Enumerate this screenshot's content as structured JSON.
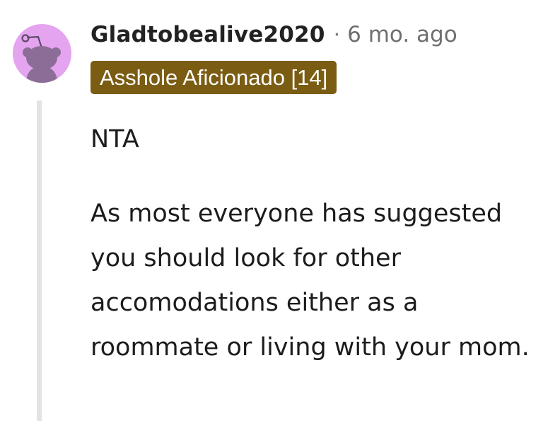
{
  "comment": {
    "author": "Gladtobealive2020",
    "separator": "·",
    "timestamp": "6 mo. ago",
    "flair": "Asshole Aficionado [14]",
    "flair_color": "#7a5c12",
    "avatar": {
      "icon": "snoo-avatar-icon",
      "background_color": "#e5a4f0"
    },
    "body": {
      "verdict": "NTA",
      "paragraph": "As most everyone has suggested you should look for other accomodations either as a roommate or living with your mom."
    }
  }
}
